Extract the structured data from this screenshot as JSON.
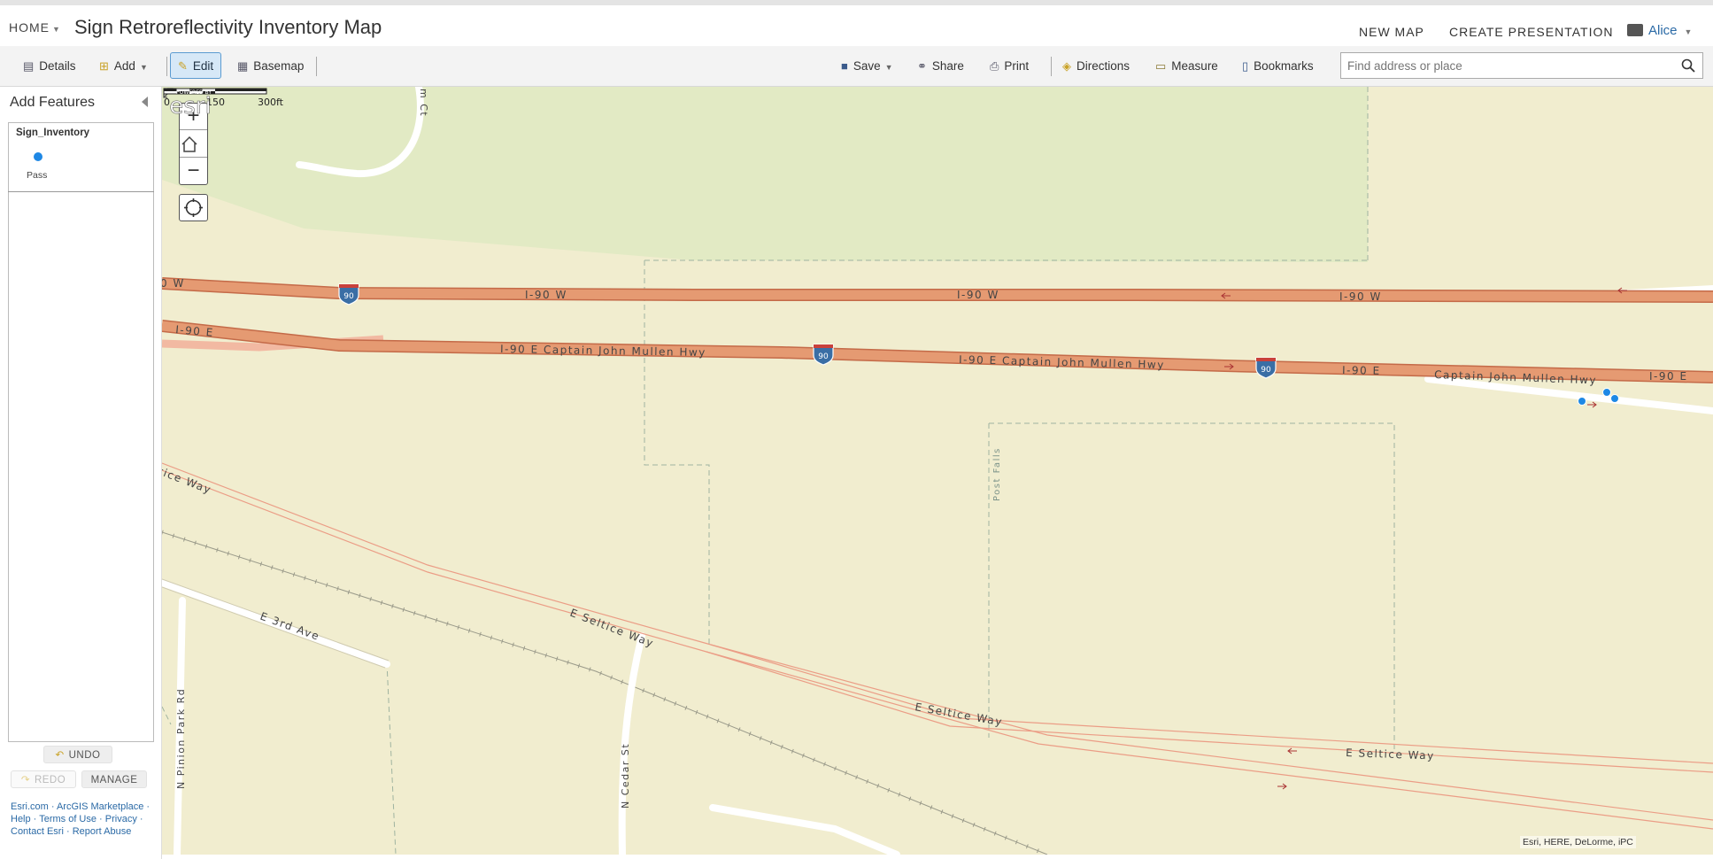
{
  "header": {
    "home_label": "HOME",
    "title": "Sign Retroreflectivity Inventory Map",
    "new_map": "NEW MAP",
    "create_presentation": "CREATE PRESENTATION",
    "user_name": "Alice"
  },
  "toolbar": {
    "details": "Details",
    "add": "Add",
    "edit": "Edit",
    "basemap": "Basemap",
    "save": "Save",
    "share": "Share",
    "print": "Print",
    "directions": "Directions",
    "measure": "Measure",
    "bookmarks": "Bookmarks",
    "search_placeholder": "Find address or place"
  },
  "panel": {
    "title": "Add Features",
    "layer_name": "Sign_Inventory",
    "template_label": "Pass",
    "undo": "UNDO",
    "redo": "REDO",
    "manage": "MANAGE",
    "links": [
      "Esri.com",
      "ArcGIS Marketplace",
      "Help",
      "Terms of Use",
      "Privacy",
      "Contact Esri",
      "Report Abuse"
    ]
  },
  "map": {
    "road_labels": {
      "i90w_a": "0  W",
      "i90w_b": "I-90  W",
      "i90w_c": "I-90  W",
      "i90w_d": "I-90  W",
      "i90e_a": "I-90  E",
      "i90e_b": "I-90  E Captain  John  Mullen  Hwy",
      "i90e_c": "I-90  E Captain  John  Mullen  Hwy",
      "i90e_d": "I-90  E",
      "captain": "Captain  John  Mullen  Hwy",
      "i90e_e": "I-90  E",
      "shield": "90",
      "seltice_a": "tice  Way",
      "seltice_b": "E  Seltice  Way",
      "seltice_c": "E  Seltice  Way",
      "seltice_d": "E  Seltice  Way",
      "third_ave": "E  3rd  Ave",
      "pinion": "N  Pinion  Park  Rd",
      "cedar": "N  Cedar  St",
      "post_falls": "Post Falls",
      "top_street": "m  Ct"
    },
    "scale": {
      "l0": "0",
      "l1": "150",
      "l2": "300ft"
    },
    "attribution": "Esri, HERE, DeLorme, iPC",
    "esri_powered": "POWERED BY",
    "esri_logo": "esri",
    "sign_points": [
      {
        "layer": "Sign_Inventory",
        "type": "Pass"
      },
      {
        "layer": "Sign_Inventory",
        "type": "Pass"
      },
      {
        "layer": "Sign_Inventory",
        "type": "Pass"
      }
    ],
    "colors": {
      "land": "#f1edcf",
      "park": "#e2eac4",
      "highway": "#e59a72",
      "highway_edge": "#c46a48",
      "ramp": "#f2b9a2",
      "point": "#1e88e5"
    }
  }
}
